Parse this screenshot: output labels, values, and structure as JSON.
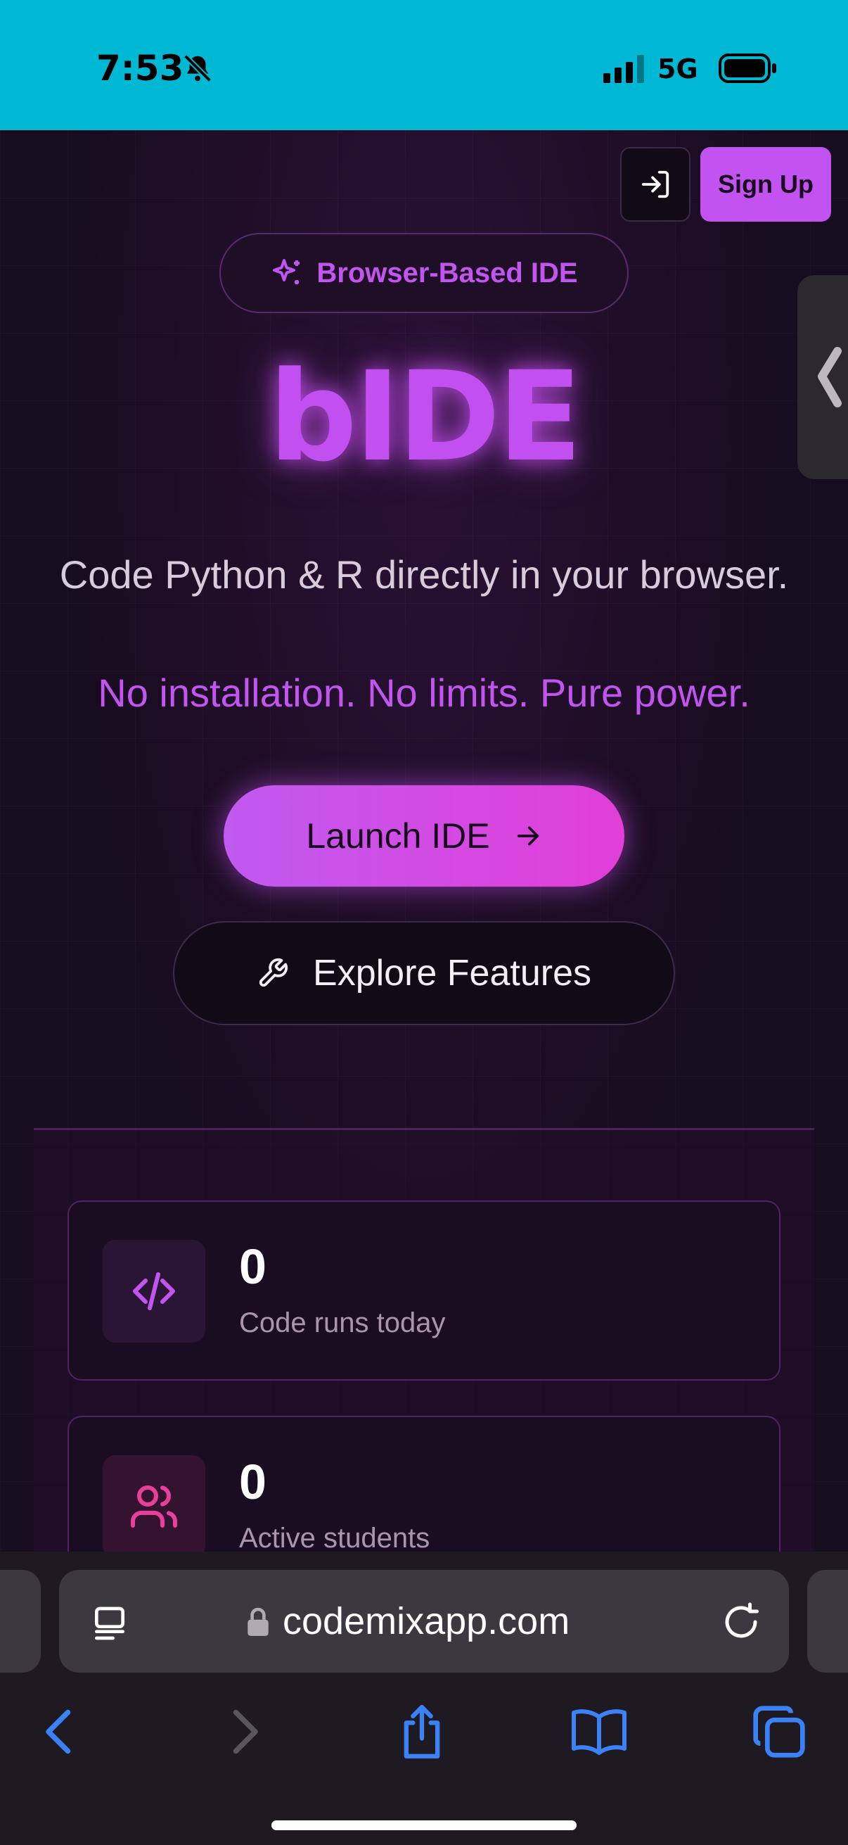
{
  "status_bar": {
    "time": "7:53",
    "network": "5G",
    "bg_color": "#00b8d4"
  },
  "header": {
    "login_icon": "login-arrow-icon",
    "signup_label": "Sign Up"
  },
  "hero": {
    "badge_label": "Browser-Based IDE",
    "badge_icon": "sparkle-icon",
    "logo_text": "bIDE",
    "tagline": "Code Python & R directly in your browser.",
    "tagline_accent": "No installation. No limits. Pure power.",
    "launch_label": "Launch IDE",
    "explore_label": "Explore Features"
  },
  "stats": [
    {
      "value": "0",
      "label": "Code runs today",
      "icon": "code-icon"
    },
    {
      "value": "0",
      "label": "Active students",
      "icon": "users-icon"
    }
  ],
  "browser": {
    "url": "codemixapp.com"
  },
  "colors": {
    "accent": "#c255f0",
    "accent_pink": "#e23ed8",
    "background": "#180c1f"
  }
}
